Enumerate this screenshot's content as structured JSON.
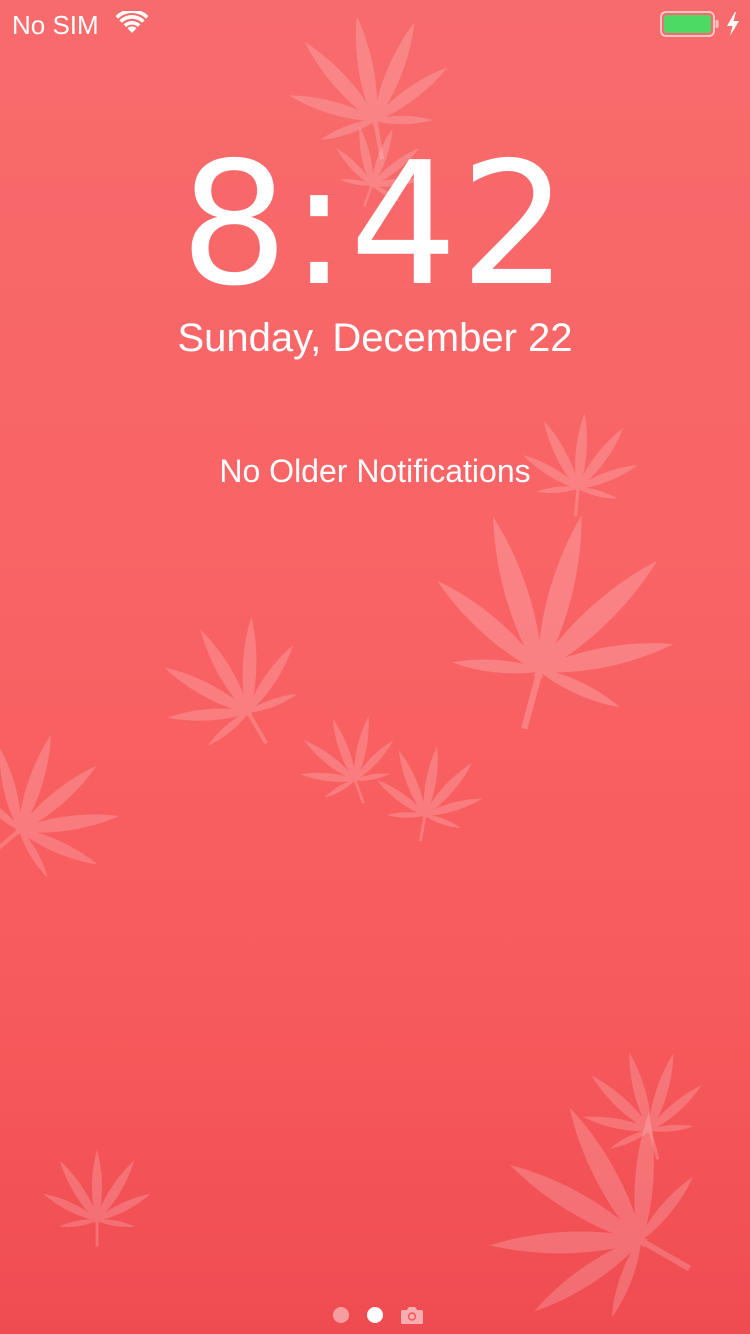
{
  "status_bar": {
    "carrier": "No SIM",
    "wifi_icon": "wifi-icon",
    "battery_icon": "battery-icon",
    "charging_icon": "lightning-bolt-icon",
    "battery_level": 1.0,
    "battery_color": "#4cd964"
  },
  "lock_screen": {
    "time": "8:42",
    "date": "Sunday, December 22",
    "notifications_label": "No Older Notifications"
  },
  "page_indicator": {
    "pages": 3,
    "current_page": 2,
    "camera_icon": "camera-icon"
  },
  "wallpaper": {
    "background_color": "#f96365",
    "motif": "cannabis-leaf"
  }
}
